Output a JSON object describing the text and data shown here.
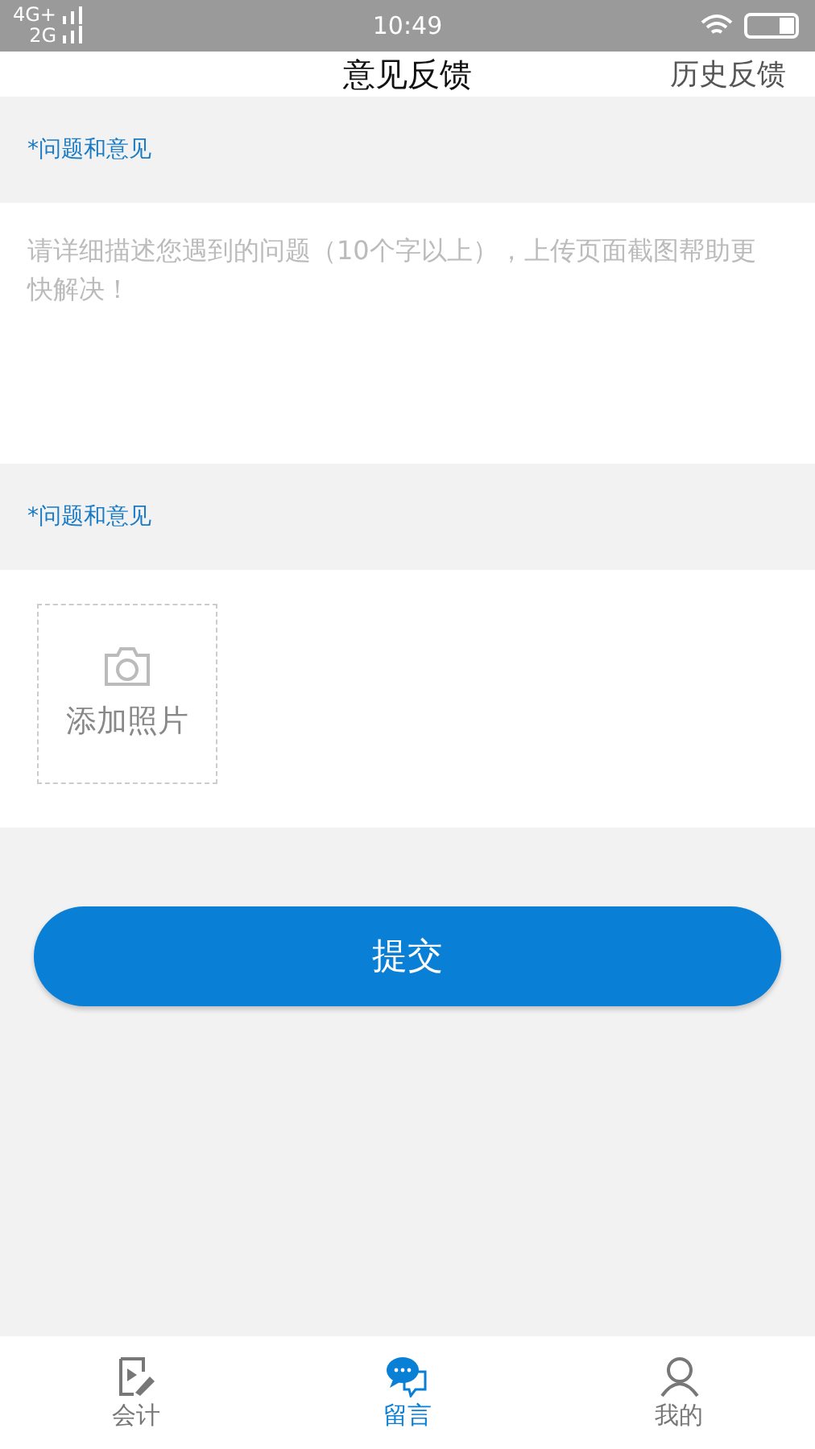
{
  "status_bar": {
    "network_1": "4G+",
    "network_2": "2G",
    "time": "10:49"
  },
  "header": {
    "title": "意见反馈",
    "action": "历史反馈"
  },
  "sections": [
    {
      "kind": "text",
      "label": "*问题和意见",
      "placeholder": "请详细描述您遇到的问题（10个字以上），上传页面截图帮助更快解决！"
    },
    {
      "kind": "photo",
      "label": "*问题和意见",
      "button": "添加照片"
    }
  ],
  "submit": "提交",
  "tabs": [
    {
      "label": "会计",
      "selected": false,
      "kind": "doc"
    },
    {
      "label": "留言",
      "selected": true,
      "kind": "chat"
    },
    {
      "label": "我的",
      "selected": false,
      "kind": "user"
    }
  ]
}
